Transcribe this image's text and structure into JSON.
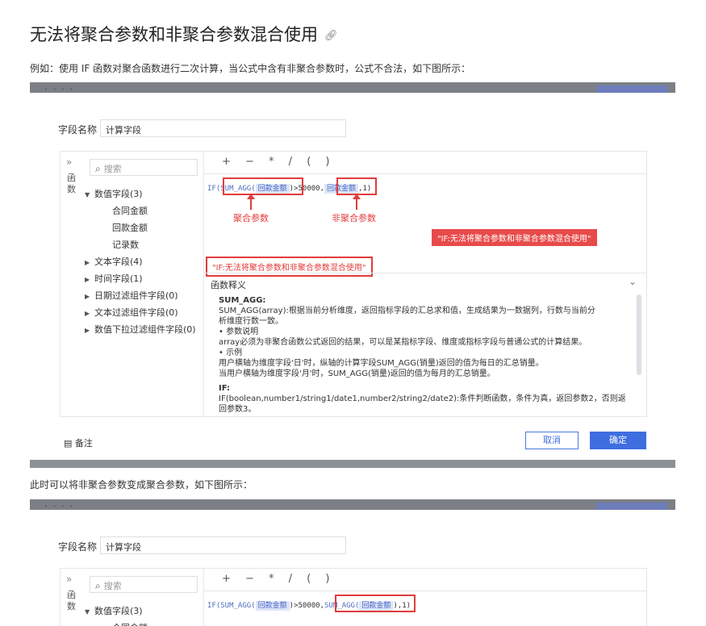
{
  "heading": "无法将聚合参数和非聚合参数混合使用",
  "paragraph1": "例如：使用 IF 函数对聚合函数进行二次计算，当公式中含有非聚合参数时，公式不合法，如下图所示：",
  "paragraph2": "此时可以将非聚合参数变成聚合参数，如下图所示：",
  "dialog": {
    "field_name_label": "字段名称",
    "field_name_value": "计算字段",
    "side_collapse": "»",
    "side_vertical_label": "函数",
    "search_placeholder": "搜索",
    "tree": {
      "numeric": "数值字段(3)",
      "numeric_children": [
        "合同金额",
        "回款金额",
        "记录数"
      ],
      "text": "文本字段(4)",
      "time": "时间字段(1)",
      "date_filter": "日期过滤组件字段(0)",
      "text_filter": "文本过滤组件字段(0)",
      "num_dropdown_filter": "数值下拉过滤组件字段(0)"
    },
    "operators": "+ − * / ( )",
    "formula1": {
      "prefix": "IF(",
      "func": "SUM_AGG(",
      "arg": "回款金额",
      "mid": ")>50000,",
      "arg2": "回款金额",
      "tail": ",1)"
    },
    "formula2": {
      "prefix": "IF(SUM_AGG(",
      "arg": "回款金额",
      "mid": ")>50000,",
      "func2": "SUM_AGG(",
      "arg2": "回款金额",
      "tail": "),1)"
    },
    "annot_agg": "聚合参数",
    "annot_nonagg": "非聚合参数",
    "error_tag": "\"IF:无法将聚合参数和非聚合参数混合使用\"",
    "error_inline": "\"IF:无法将聚合参数和非聚合参数混合使用\"",
    "fn_title": "函数释义",
    "fn_lines": {
      "t1": "SUM_AGG:",
      "l1": "SUM_AGG(array):根据当前分析维度，返回指标字段的汇总求和值，生成结果为一数据列，行数与当前分",
      "l2": "析维度行数一致。",
      "l3": "• 参数说明",
      "l4": "array必须为非聚合函数公式返回的结果，可以是某指标字段、维度或指标字段与普通公式的计算结果。",
      "l5": "• 示例",
      "l6": "用户横轴为维度字段'日'时，纵轴的计算字段SUM_AGG(销量)返回的值为每日的汇总销量。",
      "l7": "当用户横轴为维度字段'月'时，SUM_AGG(销量)返回的值为每月的汇总销量。",
      "t2": "IF:",
      "l8": "IF(boolean,number1/string1/date1,number2/string2/date2):条件判断函数，条件为真，返回参数2，否则返",
      "l9": "回参数3。"
    },
    "note_label": "备注",
    "cancel": "取消",
    "ok": "确定"
  },
  "icons": {
    "link": "link-icon",
    "search": "search-icon",
    "chevron": "chevron-down-icon",
    "note": "note-icon"
  },
  "colors": {
    "accent": "#3f6ee0",
    "error": "#e23c3c",
    "chip": "#dde5f8"
  }
}
